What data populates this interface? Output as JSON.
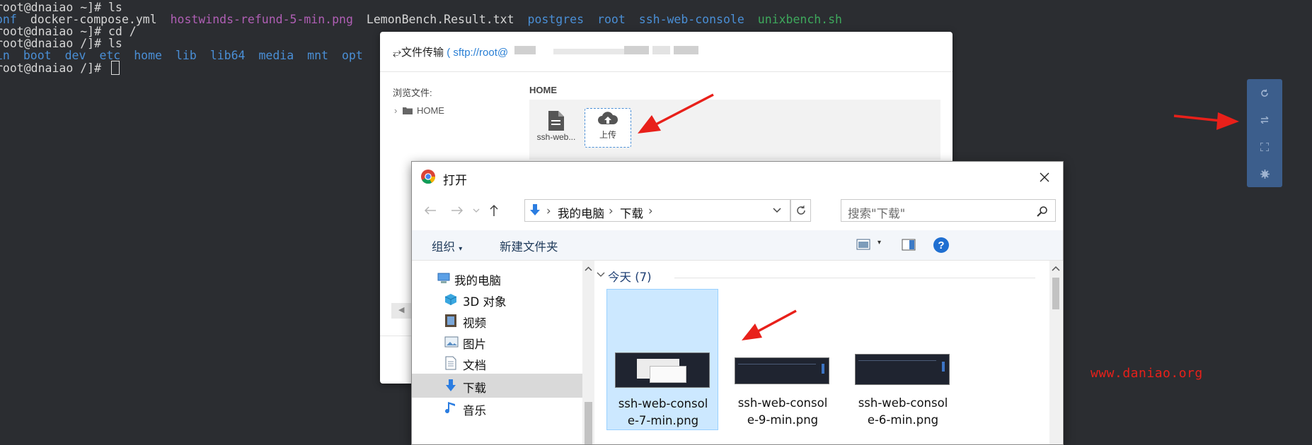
{
  "terminal": {
    "lines": [
      {
        "prompt": "root@dnaiao ~]# ls"
      },
      {
        "files": [
          "onf",
          "docker-compose.yml",
          "hostwinds-refund-5-min.png",
          "LemonBench.Result.txt",
          "postgres",
          "root",
          "ssh-web-console",
          "unixbench.sh"
        ]
      },
      {
        "prompt": "root@dnaiao ~]# cd /"
      },
      {
        "prompt": "root@dnaiao /]# ls"
      },
      {
        "files": [
          "in",
          "boot",
          "dev",
          "etc",
          "home",
          "lib",
          "lib64",
          "media",
          "mnt",
          "opt"
        ]
      },
      {
        "prompt": "root@dnaiao /]# "
      }
    ]
  },
  "sftp": {
    "title": "文件传输",
    "host_prefix": "( sftp://root@",
    "browse_label": "浏览文件:",
    "tree_root": "HOME",
    "current_dir": "HOME",
    "files": [
      {
        "name": "ssh-web...",
        "icon": "file-icon"
      },
      {
        "name": "上传",
        "icon": "cloud-upload-icon"
      }
    ]
  },
  "toolbar": {
    "buttons": [
      "refresh-icon",
      "transfer-icon",
      "fullscreen-icon",
      "settings-icon"
    ],
    "bg_color": "#3c5e8c"
  },
  "dialog": {
    "title": "打开",
    "breadcrumb": [
      "我的电脑",
      "下载"
    ],
    "search_placeholder": "搜索\"下载\"",
    "organize": "组织",
    "new_folder": "新建文件夹",
    "nav_items": [
      {
        "label": "我的电脑",
        "icon": "computer-icon"
      },
      {
        "label": "3D 对象",
        "icon": "cube-icon"
      },
      {
        "label": "视频",
        "icon": "video-icon"
      },
      {
        "label": "图片",
        "icon": "picture-icon"
      },
      {
        "label": "文档",
        "icon": "document-icon"
      },
      {
        "label": "下载",
        "icon": "download-icon",
        "selected": true
      },
      {
        "label": "音乐",
        "icon": "music-icon"
      }
    ],
    "group_header": "今天 (7)",
    "files": [
      {
        "line1": "ssh-web-consol",
        "line2": "e-7-min.png",
        "selected": true
      },
      {
        "line1": "ssh-web-consol",
        "line2": "e-9-min.png"
      },
      {
        "line1": "ssh-web-consol",
        "line2": "e-6-min.png"
      }
    ]
  },
  "watermark": "www.daniao.org",
  "colors": {
    "annotation": "#e8201a",
    "link": "#2a7fd4"
  }
}
